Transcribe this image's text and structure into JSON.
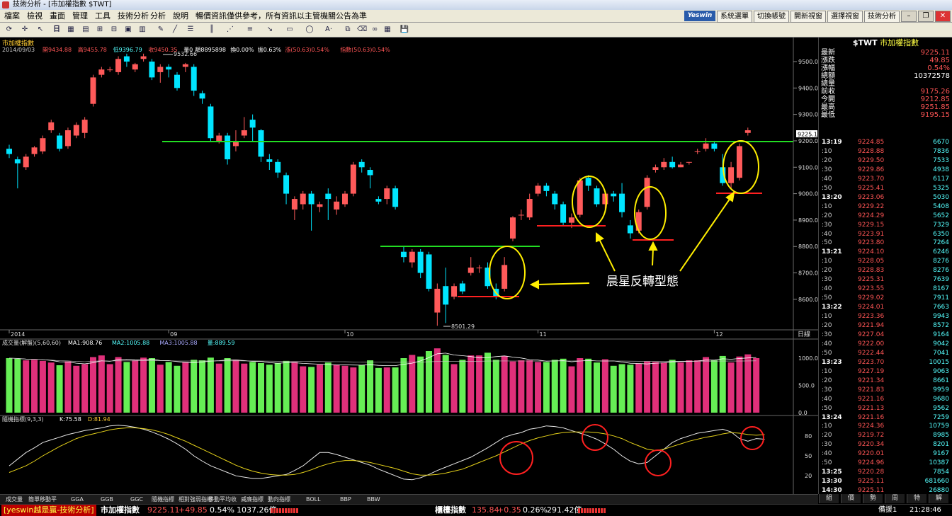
{
  "window": {
    "title": "技術分析 - [市加權指數 $TWT]"
  },
  "menu": [
    "檔案",
    "檢視",
    "畫面",
    "管理",
    "工具",
    "技術分析",
    "分析",
    "說明",
    "暢價資訊僅供參考，所有資訊以主管機關公告為準"
  ],
  "topbar": {
    "logo": "Yeswin",
    "buttons": [
      "系統選單",
      "切換帳號",
      "開新視窗",
      "選擇視窗",
      "技術分析"
    ]
  },
  "toolbar": {
    "period": "日",
    "font": "A·"
  },
  "chart": {
    "name": "市加權指數",
    "date": "2014/09/03",
    "info": [
      {
        "text": "開9434.88",
        "color": "#ff5555"
      },
      {
        "text": "高9455.78",
        "color": "#ff5555"
      },
      {
        "text": "低9396.79",
        "color": "#55ffff"
      },
      {
        "text": "收9450.35",
        "color": "#ff5555"
      },
      {
        "text": "量0",
        "color": "#ffffff"
      },
      {
        "text": "額8895898",
        "color": "#ffffff"
      },
      {
        "text": "換0.00%",
        "color": "#ffffff"
      },
      {
        "text": "振0.63%",
        "color": "#ffffff"
      },
      {
        "text": "漲(50.63)0.54%",
        "color": "#ff5555"
      },
      {
        "text": "指數(50.63)0.54%",
        "color": "#ff5555"
      }
    ],
    "yticks": [
      "9500.0",
      "9400.0",
      "9300.0",
      "9200.0",
      "9100.0",
      "9000.0",
      "8900.0",
      "8800.0",
      "8700.0",
      "8600.0"
    ],
    "price_tag": "9225.1",
    "months": [
      {
        "label": "2014",
        "i": 0
      },
      {
        "label": "09",
        "i": 19
      },
      {
        "label": "10",
        "i": 40
      },
      {
        "label": "11",
        "i": 63
      },
      {
        "label": "12",
        "i": 84
      }
    ],
    "date_label": "日線",
    "high_label": "9532.66",
    "low_label": "8501.29",
    "annotation": "晨星反轉型態",
    "candles": [
      [
        9170,
        9150,
        9135,
        9185
      ],
      [
        9130,
        9115,
        9020,
        9140
      ],
      [
        9100,
        9140,
        9090,
        9150
      ],
      [
        9150,
        9175,
        9140,
        9180
      ],
      [
        9160,
        9210,
        9150,
        9220
      ],
      [
        9240,
        9270,
        9230,
        9280
      ],
      [
        9220,
        9170,
        9160,
        9230
      ],
      [
        9180,
        9240,
        9170,
        9250
      ],
      [
        9220,
        9260,
        9210,
        9270
      ],
      [
        9230,
        9280,
        9210,
        9290
      ],
      [
        9340,
        9440,
        9330,
        9450
      ],
      [
        9450,
        9470,
        9440,
        9480
      ],
      [
        9470,
        9470,
        9460,
        9480
      ],
      [
        9460,
        9510,
        9450,
        9520
      ],
      [
        9520,
        9500,
        9480,
        9530
      ],
      [
        9470,
        9490,
        9460,
        9495
      ],
      [
        9510,
        9520,
        9500,
        9530
      ],
      [
        9500,
        9440,
        9430,
        9510
      ],
      [
        9460,
        9480,
        9420,
        9490
      ],
      [
        9480,
        9470,
        9440,
        9490
      ],
      [
        9450,
        9400,
        9390,
        9460
      ],
      [
        9480,
        9490,
        9460,
        9495
      ],
      [
        9480,
        9390,
        9370,
        9490
      ],
      [
        9380,
        9360,
        9340,
        9390
      ],
      [
        9330,
        9210,
        9200,
        9340
      ],
      [
        9200,
        9220,
        9190,
        9230
      ],
      [
        9220,
        9130,
        9110,
        9230
      ],
      [
        9180,
        9200,
        9160,
        9240
      ],
      [
        9220,
        9240,
        9210,
        9290
      ],
      [
        9280,
        9250,
        9200,
        9300
      ],
      [
        9240,
        9140,
        9120,
        9245
      ],
      [
        9130,
        9120,
        9090,
        9150
      ],
      [
        9120,
        9080,
        9060,
        9130
      ],
      [
        9070,
        9000,
        8960,
        9080
      ],
      [
        8940,
        8980,
        8900,
        8990
      ],
      [
        8960,
        9000,
        8940,
        9010
      ],
      [
        9000,
        8960,
        8860,
        9010
      ],
      [
        8950,
        8960,
        8930,
        8970
      ],
      [
        9000,
        8980,
        8900,
        9020
      ],
      [
        8940,
        8970,
        8920,
        8990
      ],
      [
        8960,
        9000,
        8950,
        9010
      ],
      [
        9000,
        9110,
        8990,
        9120
      ],
      [
        9120,
        9100,
        9080,
        9130
      ],
      [
        9090,
        9070,
        9020,
        9100
      ],
      [
        8980,
        8970,
        8960,
        8990
      ],
      [
        8980,
        9020,
        8960,
        9030
      ],
      [
        9020,
        8950,
        8940,
        9030
      ],
      [
        8780,
        8760,
        8740,
        8800
      ],
      [
        8740,
        8780,
        8720,
        8790
      ],
      [
        8780,
        8700,
        8680,
        8790
      ],
      [
        8770,
        8640,
        8630,
        8780
      ],
      [
        8550,
        8640,
        8500,
        8660
      ],
      [
        8650,
        8580,
        8510,
        8720
      ],
      [
        8610,
        8650,
        8600,
        8660
      ],
      [
        8660,
        8630,
        8620,
        8670
      ],
      [
        8700,
        8720,
        8690,
        8760
      ],
      [
        8720,
        8720,
        8700,
        8730
      ],
      [
        8720,
        8650,
        8640,
        8740
      ],
      [
        8640,
        8610,
        8600,
        8660
      ],
      [
        8640,
        8730,
        8630,
        8760
      ],
      [
        8830,
        8910,
        8820,
        8915
      ],
      [
        8920,
        8920,
        8900,
        8940
      ],
      [
        8910,
        8980,
        8900,
        9000
      ],
      [
        9000,
        9030,
        8990,
        9040
      ],
      [
        9030,
        9010,
        8990,
        9040
      ],
      [
        9000,
        8960,
        8940,
        9010
      ],
      [
        8960,
        8890,
        8880,
        8970
      ],
      [
        8890,
        8910,
        8870,
        8925
      ],
      [
        8920,
        9050,
        8910,
        9060
      ],
      [
        9060,
        9030,
        9010,
        9070
      ],
      [
        9020,
        8960,
        8950,
        9030
      ],
      [
        8960,
        9000,
        8940,
        9010
      ],
      [
        9000,
        8990,
        8970,
        9010
      ],
      [
        9000,
        8930,
        8910,
        9040
      ],
      [
        8880,
        8850,
        8830,
        8900
      ],
      [
        8860,
        8930,
        8850,
        8940
      ],
      [
        8950,
        9060,
        8940,
        9070
      ],
      [
        9090,
        9100,
        9080,
        9110
      ],
      [
        9100,
        9120,
        9090,
        9135
      ],
      [
        9120,
        9100,
        9095,
        9140
      ],
      [
        9100,
        9110,
        9100,
        9120
      ],
      [
        9120,
        9120,
        9110,
        9120
      ],
      [
        9160,
        9160,
        9150,
        9170
      ],
      [
        9170,
        9190,
        9160,
        9210
      ],
      [
        9190,
        9170,
        9160,
        9200
      ],
      [
        9100,
        9040,
        9030,
        9150
      ],
      [
        9040,
        9100,
        9020,
        9120
      ],
      [
        9060,
        9180,
        9050,
        9190
      ],
      [
        9230,
        9240,
        9220,
        9250
      ]
    ]
  },
  "volume": {
    "title": "成交量(解盤)(5,60,60)",
    "ma": [
      {
        "text": "MA1:908.76",
        "color": "#ffffff"
      },
      {
        "text": "MA2:1005.88",
        "color": "#55ffff"
      },
      {
        "text": "MA3:1005.88",
        "color": "#aaaaff"
      },
      {
        "text": "量:889.59",
        "color": "#55ffff"
      }
    ],
    "yticks": [
      "1000.0",
      "500.0",
      "0.0"
    ],
    "values": [
      1000,
      990,
      960,
      970,
      950,
      920,
      870,
      940,
      860,
      890,
      1020,
      1050,
      890,
      1020,
      930,
      960,
      1010,
      1000,
      880,
      930,
      860,
      930,
      970,
      960,
      1010,
      900,
      1000,
      970,
      900,
      930,
      910,
      880,
      910,
      950,
      930,
      850,
      840,
      880,
      920,
      880,
      860,
      830,
      870,
      960,
      820,
      830,
      830,
      1000,
      1060,
      1030,
      1130,
      1180,
      1060,
      890,
      970,
      1050,
      1050,
      1100,
      970,
      1040,
      940,
      960,
      960,
      930,
      930,
      970,
      990,
      850,
      1000,
      990,
      920,
      980,
      860,
      890,
      880,
      900,
      940,
      930,
      920,
      970,
      920,
      960,
      960,
      1020,
      960,
      1040,
      920,
      1030,
      1070,
      1000
    ]
  },
  "kd": {
    "title": "隨機指標(9,3,3)",
    "k": "K:75.58",
    "d": "D:81.94",
    "yticks": [
      "80",
      "50",
      "20"
    ],
    "k_values": [
      35,
      45,
      55,
      62,
      70,
      74,
      78,
      82,
      85,
      88,
      90,
      92,
      95,
      96,
      95,
      93,
      90,
      86,
      81,
      75,
      68,
      60,
      50,
      42,
      35,
      30,
      25,
      20,
      18,
      16,
      16,
      18,
      20,
      22,
      28,
      35,
      45,
      55,
      55,
      52,
      48,
      44,
      40,
      36,
      30,
      25,
      20,
      15,
      14,
      17,
      22,
      28,
      33,
      38,
      43,
      48,
      55,
      62,
      70,
      78,
      82,
      85,
      90,
      92,
      95,
      94,
      92,
      88,
      84,
      80,
      75,
      68,
      60,
      50,
      42,
      38,
      40,
      50,
      60,
      70,
      76,
      80,
      84,
      86,
      88,
      90,
      86,
      76,
      72,
      76,
      75
    ],
    "d_values": [
      25,
      30,
      35,
      42,
      50,
      57,
      64,
      70,
      76,
      80,
      83,
      86,
      89,
      91,
      92,
      92,
      91,
      89,
      86,
      82,
      77,
      72,
      66,
      60,
      54,
      48,
      42,
      36,
      31,
      27,
      24,
      22,
      21,
      21,
      22,
      25,
      29,
      34,
      38,
      41,
      43,
      43,
      42,
      40,
      37,
      34,
      31,
      27,
      23,
      21,
      21,
      22,
      24,
      27,
      30,
      35,
      40,
      45,
      50,
      56,
      62,
      68,
      73,
      77,
      80,
      83,
      85,
      86,
      86,
      86,
      85,
      83,
      80,
      76,
      70,
      65,
      60,
      58,
      60,
      64,
      68,
      72,
      75,
      78,
      80,
      83,
      85,
      84,
      82,
      81,
      82
    ]
  },
  "tabs": [
    "成交量",
    "簡單移動平",
    "GGA",
    "GGB",
    "GGC",
    "隨機指標",
    "相對強弱指標",
    "移動平均收",
    "威廉指標",
    "動向指標",
    "BOLL",
    "BBP",
    "BBW"
  ],
  "quote": {
    "title_code": "$TWT",
    "title_name": "市加權指數",
    "rows": [
      {
        "k": "最新",
        "v": "9225.11"
      },
      {
        "k": "漲跌",
        "v": "49.85"
      },
      {
        "k": "漲幅",
        "v": "0.54%"
      },
      {
        "k": "總額",
        "v": "10372578"
      },
      {
        "k": "總量",
        "v": ""
      },
      {
        "k": "前收",
        "v": "9175.26"
      },
      {
        "k": "今開",
        "v": "9212.85"
      },
      {
        "k": "最高",
        "v": "9251.85"
      },
      {
        "k": "最低",
        "v": "9195.15"
      }
    ],
    "ticks": [
      [
        "13:19",
        "9224.85",
        "6670"
      ],
      [
        ":10",
        "9228.88",
        "7836"
      ],
      [
        ":20",
        "9229.50",
        "7533"
      ],
      [
        ":30",
        "9229.86",
        "4938"
      ],
      [
        ":40",
        "9223.70",
        "6117"
      ],
      [
        ":50",
        "9225.41",
        "5325"
      ],
      [
        "13:20",
        "9223.06",
        "5030"
      ],
      [
        ":10",
        "9229.22",
        "5408"
      ],
      [
        ":20",
        "9224.29",
        "5652"
      ],
      [
        ":30",
        "9229.15",
        "7329"
      ],
      [
        ":40",
        "9223.91",
        "6350"
      ],
      [
        ":50",
        "9223.80",
        "7264"
      ],
      [
        "13:21",
        "9224.10",
        "6246"
      ],
      [
        ":10",
        "9228.05",
        "8276"
      ],
      [
        ":20",
        "9228.83",
        "8276"
      ],
      [
        ":30",
        "9225.31",
        "7639"
      ],
      [
        ":40",
        "9223.55",
        "8167"
      ],
      [
        ":50",
        "9229.02",
        "7911"
      ],
      [
        "13:22",
        "9224.01",
        "7663"
      ],
      [
        ":10",
        "9223.36",
        "9943"
      ],
      [
        ":20",
        "9221.94",
        "8572"
      ],
      [
        ":30",
        "9227.04",
        "9164"
      ],
      [
        ":40",
        "9222.00",
        "9042"
      ],
      [
        ":50",
        "9222.44",
        "7041"
      ],
      [
        "13:23",
        "9223.70",
        "10015"
      ],
      [
        ":10",
        "9227.19",
        "9063"
      ],
      [
        ":20",
        "9221.34",
        "8661"
      ],
      [
        ":30",
        "9221.83",
        "9959"
      ],
      [
        ":40",
        "9221.16",
        "9680"
      ],
      [
        ":50",
        "9221.13",
        "9562"
      ],
      [
        "13:24",
        "9221.16",
        "7259"
      ],
      [
        ":10",
        "9224.36",
        "10759"
      ],
      [
        ":20",
        "9219.72",
        "8985"
      ],
      [
        ":30",
        "9220.34",
        "8201"
      ],
      [
        ":40",
        "9220.01",
        "9167"
      ],
      [
        ":50",
        "9224.96",
        "10387"
      ],
      [
        "13:25",
        "9220.28",
        "7854"
      ],
      [
        "13:30",
        "9225.11",
        "681660"
      ],
      [
        "14:30",
        "9225.11",
        "26880"
      ]
    ],
    "tabs": [
      "組",
      "價",
      "勢",
      "周",
      "特",
      "解"
    ]
  },
  "status": {
    "brand": "[yeswin越是贏-技術分析]",
    "index1_name": "市加權指數",
    "index1_price": "9225.11",
    "index1_change": "+49.85",
    "index1_pct": "0.54%",
    "index1_amount": "1037.26億",
    "index2_name": "櫃檯指數",
    "index2_price": "135.84",
    "index2_change": "+0.35",
    "index2_pct": "0.26%",
    "index2_amount": "291.42億",
    "connection": "備援1",
    "time": "21:28:46"
  },
  "colors": {
    "up": "#ff5a5a",
    "down": "#00e5ff",
    "vol_up": "#e0307a",
    "vol_down": "#66ee55",
    "support": "#ff2020",
    "resist": "#22dd22",
    "highlight": "#ffee00",
    "circle": "#ff2020"
  }
}
